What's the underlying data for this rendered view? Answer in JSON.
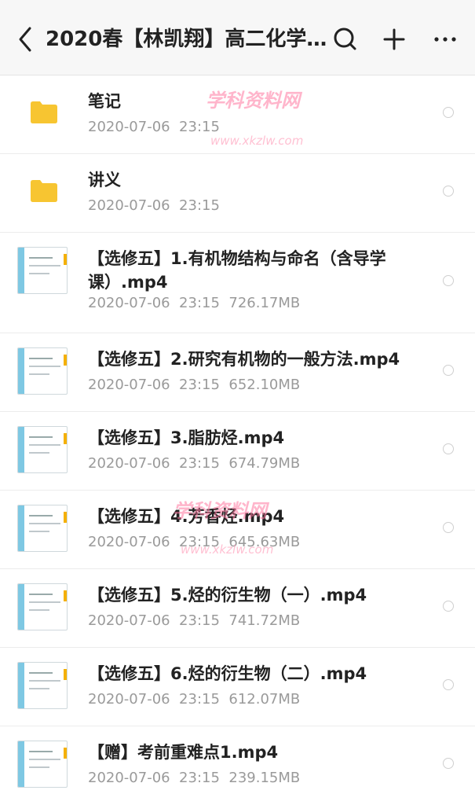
{
  "header": {
    "title": "2020春【林凯翔】高二化学...",
    "icons": [
      "back-arrow-icon",
      "search-icon",
      "plus-icon",
      "more-icon"
    ]
  },
  "files": [
    {
      "type": "folder",
      "name": "笔记",
      "meta": "2020-07-06  23:15"
    },
    {
      "type": "folder",
      "name": "讲义",
      "meta": "2020-07-06  23:15"
    },
    {
      "type": "video",
      "name": "【选修五】1.有机物结构与命名（含导学课）.mp4",
      "meta": "2020-07-06  23:15  726.17MB"
    },
    {
      "type": "video",
      "name": "【选修五】2.研究有机物的一般方法.mp4",
      "meta": "2020-07-06  23:15  652.10MB"
    },
    {
      "type": "video",
      "name": "【选修五】3.脂肪烃.mp4",
      "meta": "2020-07-06  23:15  674.79MB"
    },
    {
      "type": "video",
      "name": "【选修五】4.芳香烃.mp4",
      "meta": "2020-07-06  23:15  645.63MB"
    },
    {
      "type": "video",
      "name": "【选修五】5.烃的衍生物（一）.mp4",
      "meta": "2020-07-06  23:15  741.72MB"
    },
    {
      "type": "video",
      "name": "【选修五】6.烃的衍生物（二）.mp4",
      "meta": "2020-07-06  23:15  612.07MB"
    },
    {
      "type": "video",
      "name": "【赠】考前重难点1.mp4",
      "meta": "2020-07-06  23:15  239.15MB"
    }
  ],
  "watermark": {
    "text": "学科资料网",
    "url": "www.xkzlw.com"
  },
  "colors": {
    "folder": "#f7c531",
    "accent": "#7ec8e3"
  }
}
